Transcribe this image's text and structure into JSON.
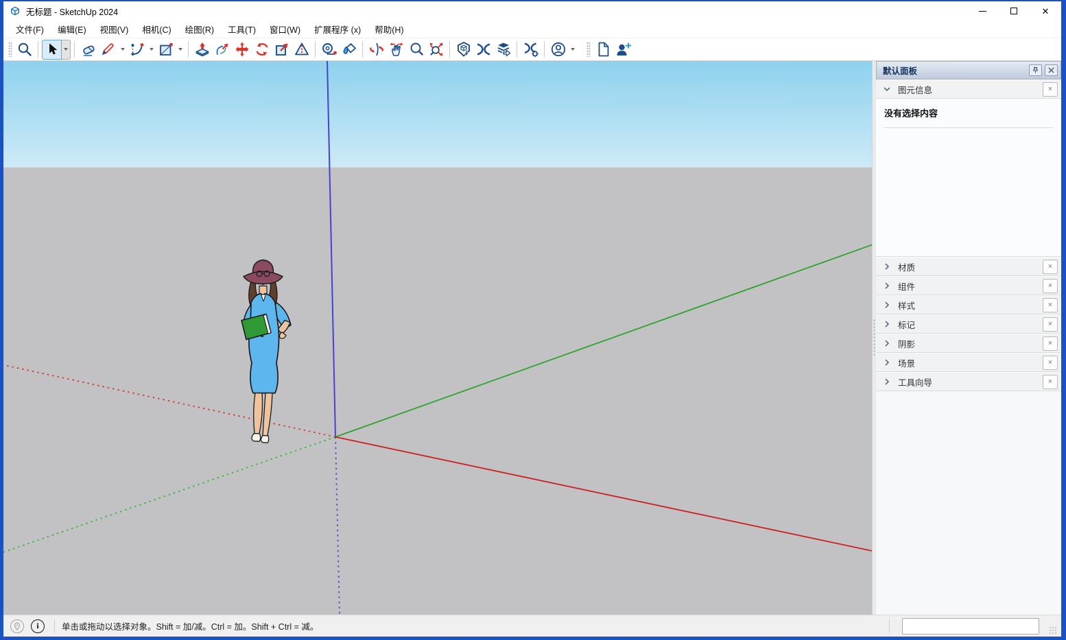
{
  "window": {
    "title": "无标题 - SketchUp 2024"
  },
  "menubar": {
    "items": [
      "文件(F)",
      "编辑(E)",
      "视图(V)",
      "相机(C)",
      "绘图(R)",
      "工具(T)",
      "窗口(W)",
      "扩展程序 (x)",
      "帮助(H)"
    ]
  },
  "toolbar": {
    "icons": [
      "search-icon",
      "select-icon",
      "select-dropdown-icon",
      "eraser-icon",
      "line-pencil-icon",
      "arc-icon",
      "rectangle-icon",
      "push-pull-icon",
      "follow-me-icon",
      "move-icon",
      "rotate-icon",
      "scale-icon",
      "offset-icon",
      "tape-measure-icon",
      "paint-bucket-icon",
      "orbit-icon",
      "pan-icon",
      "zoom-icon",
      "zoom-extents-icon",
      "3d-warehouse-icon",
      "extension-warehouse-icon",
      "share-model-icon",
      "extension-manager-icon",
      "account-icon",
      "new-document-icon",
      "add-collaborator-icon"
    ]
  },
  "viewport": {
    "colors": {
      "sky_top": "#8ed1ee",
      "sky_horizon": "#cdeaf7",
      "ground": "#c2c2c4",
      "axis_red": "#cc2121",
      "axis_green": "#2ea32e",
      "axis_blue": "#4343cf"
    },
    "figure": "sumele-person"
  },
  "panel": {
    "title": "默认面板",
    "entity_info": {
      "label": "图元信息",
      "empty_message": "没有选择内容"
    },
    "sections": [
      "材质",
      "组件",
      "样式",
      "标记",
      "阴影",
      "场景",
      "工具向导"
    ],
    "close_glyph": "×"
  },
  "statusbar": {
    "hint": "单击或拖动以选择对象。Shift = 加/减。Ctrl = 加。Shift + Ctrl = 减。",
    "measurement_value": ""
  }
}
